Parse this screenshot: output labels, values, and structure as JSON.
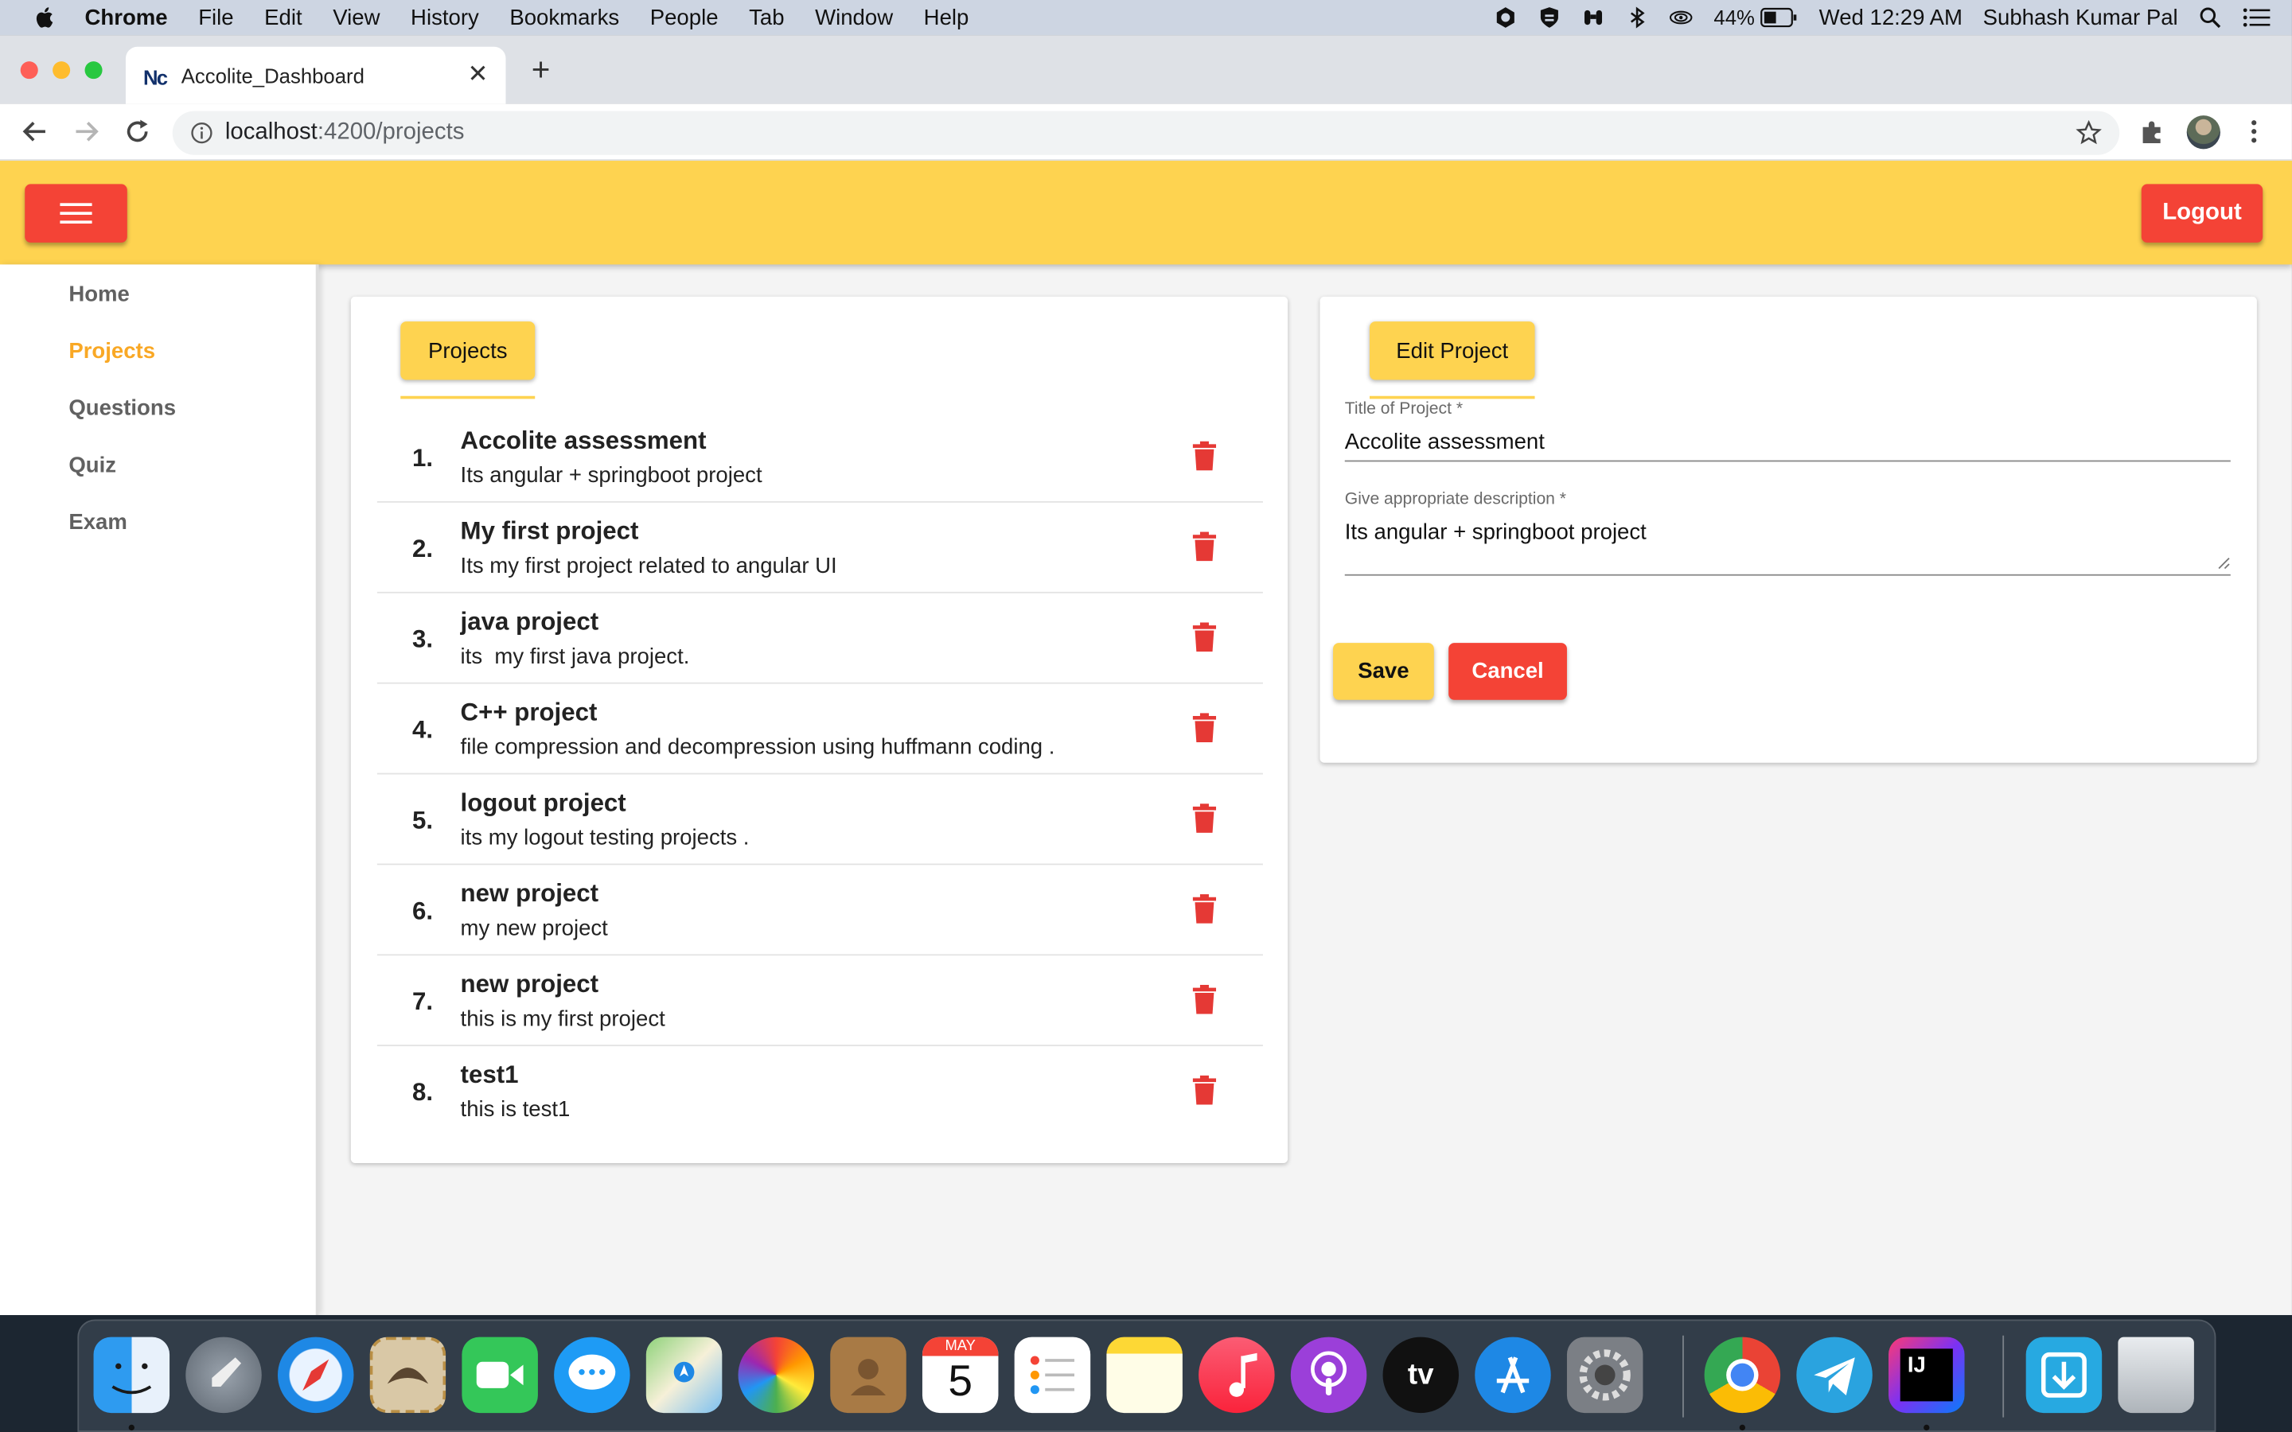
{
  "menubar": {
    "app_name": "Chrome",
    "items": [
      "File",
      "Edit",
      "View",
      "History",
      "Bookmarks",
      "People",
      "Tab",
      "Window",
      "Help"
    ],
    "battery": "44%",
    "clock": "Wed 12:29 AM",
    "user": "Subhash Kumar Pal"
  },
  "browser": {
    "tab_title": "Accolite_Dashboard",
    "favicon_text": "Nc",
    "url_host": "localhost",
    "url_rest": ":4200/projects"
  },
  "app": {
    "logout_label": "Logout",
    "nav": [
      "Home",
      "Projects",
      "Questions",
      "Quiz",
      "Exam"
    ],
    "active_nav": "Projects",
    "projects_header": "Projects",
    "projects": [
      {
        "num": "1.",
        "title": "Accolite assessment",
        "desc": "Its angular + springboot project"
      },
      {
        "num": "2.",
        "title": "My first project",
        "desc": "Its my first project related to angular UI"
      },
      {
        "num": "3.",
        "title": "java project",
        "desc": "its  my first java project."
      },
      {
        "num": "4.",
        "title": "C++ project",
        "desc": "file compression and decompression using huffmann coding ."
      },
      {
        "num": "5.",
        "title": "logout project",
        "desc": "its my logout testing projects ."
      },
      {
        "num": "6.",
        "title": "new project",
        "desc": "my new project"
      },
      {
        "num": "7.",
        "title": "new project",
        "desc": "this is my first project"
      },
      {
        "num": "8.",
        "title": "test1",
        "desc": "this is test1"
      }
    ],
    "edit": {
      "header": "Edit Project",
      "title_label": "Title of Project *",
      "title_value": "Accolite assessment",
      "desc_label": "Give appropriate description *",
      "desc_value": "Its angular + springboot project",
      "save_label": "Save",
      "cancel_label": "Cancel"
    }
  },
  "colors": {
    "accent_yellow": "#fed350",
    "danger_red": "#f44336",
    "active_nav": "#f9a825"
  },
  "dock": {
    "calendar_month": "MAY",
    "calendar_day": "5",
    "tv_label": "tv",
    "ij_label": "IJ",
    "apps": [
      "finder-icon",
      "launchpad-icon",
      "safari-icon",
      "mail-icon",
      "facetime-icon",
      "messages-icon",
      "maps-icon",
      "photos-icon",
      "contacts-icon",
      "calendar-icon",
      "reminders-icon",
      "notes-icon",
      "music-icon",
      "podcasts-icon",
      "apple-tv-icon",
      "app-store-icon",
      "system-preferences-icon",
      "chrome-icon",
      "telegram-icon",
      "intellij-icon",
      "downloads-icon",
      "trash-icon"
    ]
  }
}
